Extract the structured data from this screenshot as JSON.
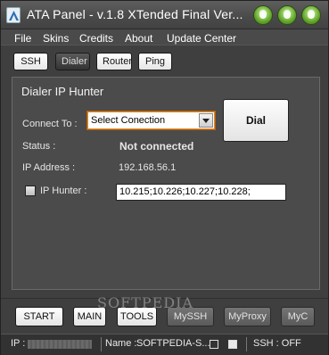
{
  "window": {
    "title": "ATA Panel - v.1.8 XTended Final Ver...",
    "accent": "#62a52a"
  },
  "menu": {
    "items": [
      "File",
      "Skins",
      "Credits",
      "About",
      "Update Center"
    ]
  },
  "tabs": [
    {
      "label": "SSH",
      "active": false
    },
    {
      "label": "Dialer",
      "active": true
    },
    {
      "label": "Router",
      "active": false
    },
    {
      "label": "Ping",
      "active": false
    }
  ],
  "panel": {
    "title": "Dialer IP Hunter",
    "connect_label": "Connect To :",
    "connection_value": "Select Conection",
    "dial_label": "Dial",
    "status_label": "Status :",
    "status_value": "Not connected",
    "ip_label": "IP Address :",
    "ip_value": "192.168.56.1",
    "hunter_label": "IP Hunter :",
    "hunter_value": "10.215;10.226;10.227;10.228;",
    "hunter_checked": false
  },
  "bottom_buttons": [
    {
      "label": "START",
      "enabled": true
    },
    {
      "label": "MAIN",
      "enabled": true
    },
    {
      "label": "TOOLS",
      "enabled": true
    },
    {
      "label": "MySSH",
      "enabled": false
    },
    {
      "label": "MyProxy",
      "enabled": false
    },
    {
      "label": "MyC",
      "enabled": false
    }
  ],
  "watermark": "SOFTPEDIA",
  "statusbar": {
    "ip_label": "IP :",
    "name_label": "Name :",
    "name_value": "SOFTPEDIA-S...",
    "ssh_status": "SSH : OFF"
  }
}
